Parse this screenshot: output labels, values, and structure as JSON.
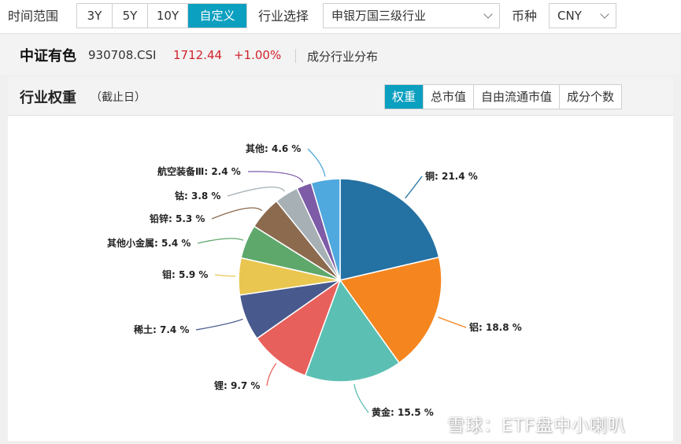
{
  "toolbar": {
    "time_range_label": "时间范围",
    "range_options": [
      "3Y",
      "5Y",
      "10Y",
      "自定义"
    ],
    "industry_label": "行业选择",
    "industry_value": "申银万国三级行业",
    "currency_label": "币种",
    "currency_value": "CNY"
  },
  "index": {
    "name": "中证有色",
    "code": "930708.CSI",
    "price": "1712.44",
    "change": "+1.00%",
    "view_label": "成分行业分布"
  },
  "panel": {
    "title": "行业权重",
    "subtitle": "（截止日）",
    "tabs": [
      "权重",
      "总市值",
      "自由流通市值",
      "成分个数"
    ]
  },
  "colors": {
    "accent": "#0b9fc0",
    "negative_red": "#d0232b"
  },
  "chart_data": {
    "type": "pie",
    "slices": [
      {
        "name": "铜",
        "value": 21.4,
        "label": "铜: 21.4 %",
        "color": "#2471a3"
      },
      {
        "name": "铝",
        "value": 18.8,
        "label": "铝: 18.8 %",
        "color": "#f5861f"
      },
      {
        "name": "黄金",
        "value": 15.5,
        "label": "黄金: 15.5 %",
        "color": "#5bbfb3"
      },
      {
        "name": "锂",
        "value": 9.7,
        "label": "锂: 9.7 %",
        "color": "#e8605c"
      },
      {
        "name": "稀土",
        "value": 7.4,
        "label": "稀土: 7.4 %",
        "color": "#485a8d"
      },
      {
        "name": "钼",
        "value": 5.9,
        "label": "钼: 5.9 %",
        "color": "#e9c650"
      },
      {
        "name": "其他小金属",
        "value": 5.4,
        "label": "其他小金属: 5.4 %",
        "color": "#5ea86c"
      },
      {
        "name": "铅锌",
        "value": 5.3,
        "label": "铅锌: 5.3 %",
        "color": "#8b6a4e"
      },
      {
        "name": "钴",
        "value": 3.8,
        "label": "钴: 3.8 %",
        "color": "#a6b0b5"
      },
      {
        "name": "航空装备Ⅲ",
        "value": 2.4,
        "label": "航空装备Ⅲ: 2.4 %",
        "color": "#7d5ba6"
      },
      {
        "name": "其他",
        "value": 4.6,
        "label": "其他: 4.6 %",
        "color": "#4fa8de"
      }
    ]
  },
  "watermark": "雪球：ETF盘中小喇叭"
}
